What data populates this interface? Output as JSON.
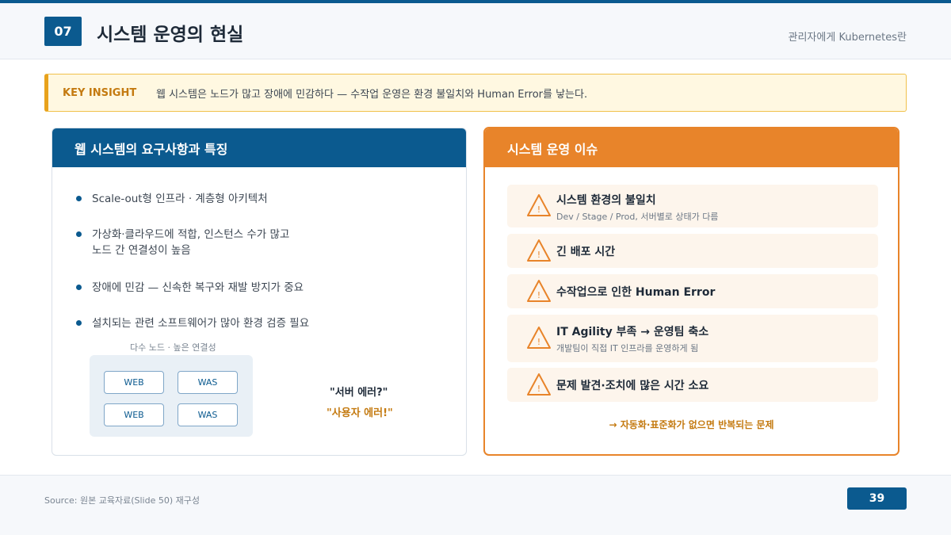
{
  "header": {
    "section_number": "07",
    "title": "시스템 운영의 현실",
    "subtitle": "관리자에게 Kubernetes란"
  },
  "insight": {
    "label": "KEY INSIGHT",
    "text": "웹 시스템은 노드가 많고 장애에 민감하다 — 수작업 운영은 환경 불일치와 Human Error를 낳는다."
  },
  "left_panel": {
    "title": "웹 시스템의 요구사항과 특징",
    "bullets": [
      {
        "line1": "Scale-out형 인프라 · 계층형 아키텍처",
        "line2": ""
      },
      {
        "line1": "가상화·클라우드에 적합, 인스턴스 수가 많고",
        "line2": "노드 간 연결성이 높음"
      },
      {
        "line1": "장애에 민감 — 신속한 복구와 재발 방지가 중요",
        "line2": ""
      },
      {
        "line1": "설치되는 관련 소프트웨어가 많아 환경 검증 필요",
        "line2": ""
      }
    ],
    "diagram": {
      "caption": "다수 노드 · 높은 연결성",
      "nodes": [
        "WEB",
        "WAS",
        "WEB",
        "WAS"
      ]
    },
    "quote_server": "\"서버 에러?\"",
    "quote_user": "\"사용자 에러!\""
  },
  "right_panel": {
    "title": "시스템 운영 이슈",
    "issues": [
      {
        "title": "시스템 환경의 불일치",
        "subtitle": "Dev / Stage / Prod, 서버별로 상태가 다름"
      },
      {
        "title": "긴 배포 시간",
        "subtitle": ""
      },
      {
        "title": "수작업으로 인한 Human Error",
        "subtitle": ""
      },
      {
        "title": "IT Agility 부족 → 운영팀 축소",
        "subtitle": "개발팀이 직접 IT 인프라를 운영하게 됨"
      },
      {
        "title": "문제 발견·조치에 많은 시간 소요",
        "subtitle": ""
      }
    ],
    "note": "→ 자동화·표준화가 없으면 반복되는 문제"
  },
  "footer": {
    "source": "Source: 원본 교육자료(Slide 50) 재구성",
    "page_number": "39"
  },
  "colors": {
    "primary": "#0b5a8f",
    "accent": "#e8842a",
    "insight_bg": "#fff8e1",
    "issue_bg": "#fdf5ec"
  },
  "icons": {
    "issue_icon": "warning-triangle-icon",
    "bullet_icon": "bullet-dot-icon"
  }
}
